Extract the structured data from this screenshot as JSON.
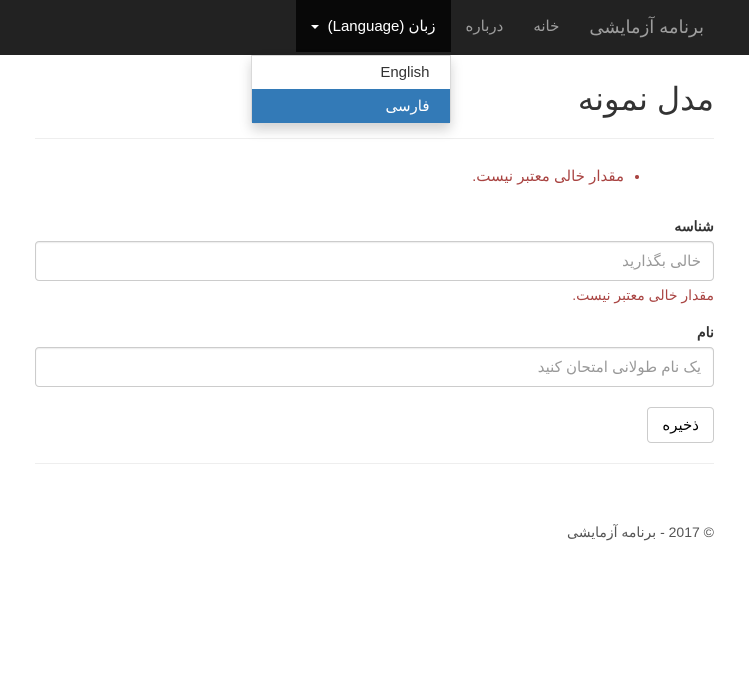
{
  "navbar": {
    "brand": "برنامه آزمایشی",
    "links": {
      "home": "خانه",
      "about": "درباره"
    },
    "language": {
      "label": "زبان (Language)",
      "options": {
        "english": "English",
        "farsi": "فارسی"
      }
    }
  },
  "page": {
    "title": "مدل نمونه",
    "errors": {
      "summary_item": "مقدار خالی معتبر نیست."
    },
    "form": {
      "id_label": "شناسه",
      "id_placeholder": "خالی بگذارید",
      "id_error": "مقدار خالی معتبر نیست.",
      "name_label": "نام",
      "name_placeholder": "یک نام طولانی امتحان کنید",
      "submit_label": "ذخیره"
    }
  },
  "footer": {
    "text": "© 2017 - برنامه آزمایشی"
  }
}
